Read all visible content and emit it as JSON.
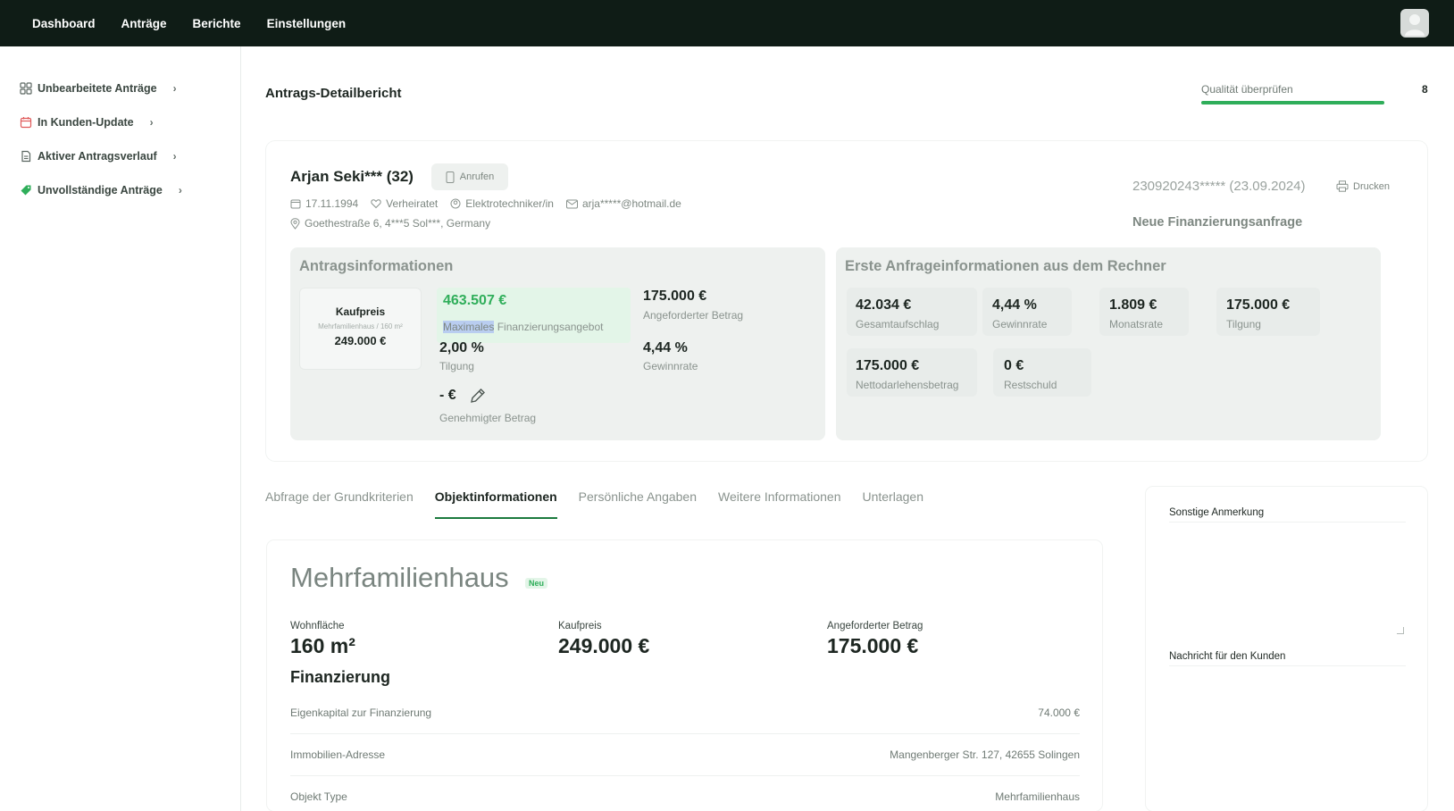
{
  "nav": {
    "items": [
      {
        "label": "Dashboard"
      },
      {
        "label": "Anträge"
      },
      {
        "label": "Berichte"
      },
      {
        "label": "Einstellungen"
      }
    ]
  },
  "sidebar": {
    "items": [
      {
        "label": "Unbearbeitete Anträge",
        "icon": "grid-icon",
        "color": "#5b6661"
      },
      {
        "label": "In Kunden-Update",
        "icon": "calendar-icon",
        "color": "#e05a5a"
      },
      {
        "label": "Aktiver Antragsverlauf",
        "icon": "document-icon",
        "color": "#5b6661"
      },
      {
        "label": "Unvollständige Anträge",
        "icon": "tag-icon",
        "color": "#2fae5a"
      }
    ]
  },
  "header": {
    "title": "Antrags-Detailbericht",
    "quality_label": "Qualität überprüfen",
    "quality_progress": 1.0,
    "quality_count": "8"
  },
  "applicant": {
    "name": "Arjan Seki*** (32)",
    "call_label": "Anrufen",
    "birthdate": "17.11.1994",
    "marital_status": "Verheiratet",
    "occupation": "Elektrotechniker/in",
    "email": "arja*****@hotmail.de",
    "address": "Goethestraße 6, 4***5 Sol***, Germany",
    "reference": "230920243***** (23.09.2024)",
    "print_label": "Drucken",
    "request_type": "Neue Finanzierungsanfrage"
  },
  "antrag": {
    "title": "Antragsinformationen",
    "kaufpreis_label": "Kaufpreis",
    "kaufpreis_sub": "Mehrfamilienhaus / 160 m²",
    "kaufpreis_value": "249.000 €",
    "max_value": "463.507 €",
    "max_label_highlight": "Maximales",
    "max_label_rest": " Finanzierungsangebot",
    "requested_value": "175.000 €",
    "requested_label": "Angeforderter Betrag",
    "tilgung_value": "2,00 %",
    "tilgung_label": "Tilgung",
    "rate_value": "4,44 %",
    "rate_label": "Gewinnrate",
    "approved_value": "- €",
    "approved_label": "Genehmigter Betrag"
  },
  "rechner": {
    "title": "Erste Anfrageinformationen aus dem Rechner",
    "tiles": [
      {
        "value": "42.034 €",
        "label": "Gesamtaufschlag"
      },
      {
        "value": "4,44 %",
        "label": "Gewinnrate"
      },
      {
        "value": "1.809 €",
        "label": "Monatsrate"
      },
      {
        "value": "175.000 €",
        "label": "Tilgung"
      },
      {
        "value": "175.000 €",
        "label": "Nettodarlehensbetrag"
      },
      {
        "value": "0 €",
        "label": "Restschuld"
      }
    ]
  },
  "tabs": [
    {
      "label": "Abfrage der Grundkriterien",
      "active": false
    },
    {
      "label": "Objektinformationen",
      "active": true
    },
    {
      "label": "Persönliche Angaben",
      "active": false
    },
    {
      "label": "Weitere Informationen",
      "active": false
    },
    {
      "label": "Unterlagen",
      "active": false
    }
  ],
  "object": {
    "title": "Mehrfamilienhaus",
    "badge": "Neu",
    "fields": [
      {
        "label": "Wohnfläche",
        "value": "160 m²"
      },
      {
        "label": "Kaufpreis",
        "value": "249.000 €"
      },
      {
        "label": "Angeforderter Betrag",
        "value": "175.000 €"
      }
    ],
    "financing_title": "Finanzierung",
    "rows": [
      {
        "label": "Eigenkapital zur Finanzierung",
        "value": "74.000 €"
      },
      {
        "label": "Immobilien-Adresse",
        "value": "Mangenberger Str. 127, 42655 Solingen"
      },
      {
        "label": "Objekt Type",
        "value": "Mehrfamilienhaus"
      }
    ]
  },
  "notes": {
    "other_label": "Sonstige Anmerkung",
    "message_label": "Nachricht für den Kunden"
  }
}
